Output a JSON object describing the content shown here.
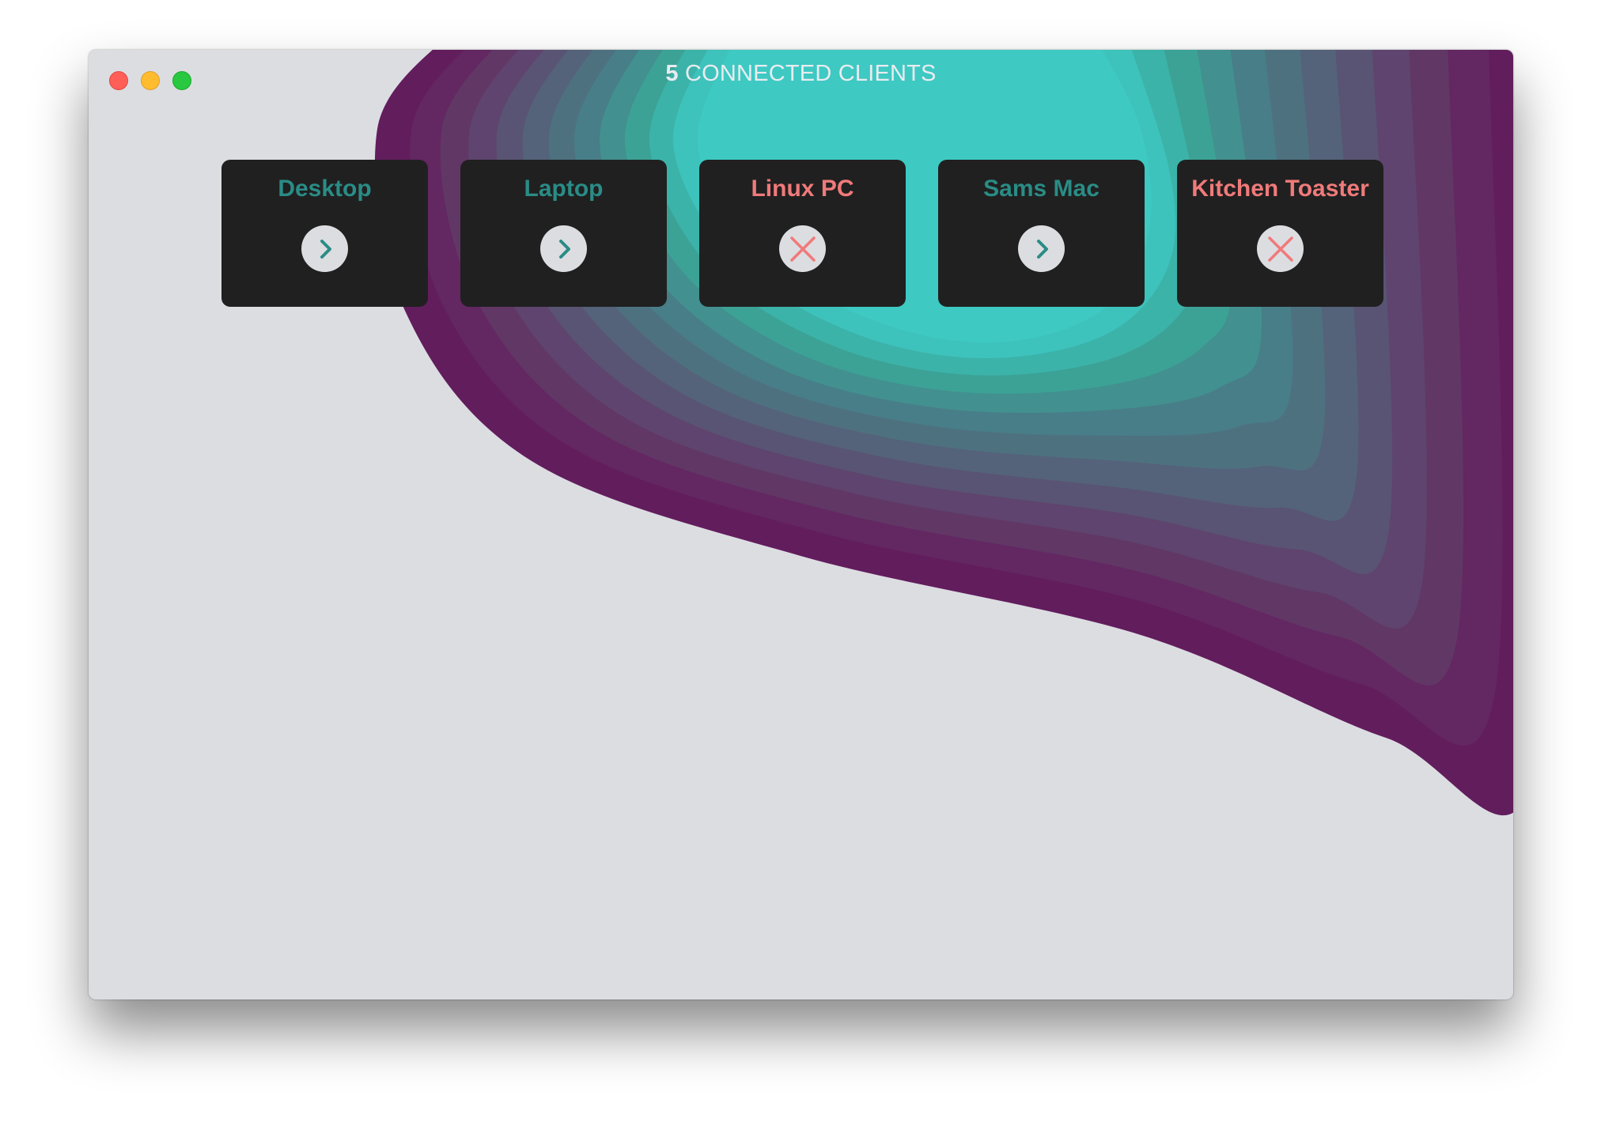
{
  "window": {
    "controls": [
      "close-icon",
      "minimize-icon",
      "maximize-icon"
    ],
    "title_count": "5",
    "title_text": "CONNECTED CLIENTS"
  },
  "colors": {
    "connected": "#2a8c86",
    "disconnected": "#f07a7a",
    "card_bg": "#202020",
    "window_bg": "#dcdde1"
  },
  "clients": [
    {
      "name": "Desktop",
      "status": "connected",
      "icon": "chevron-right-icon"
    },
    {
      "name": "Laptop",
      "status": "connected",
      "icon": "chevron-right-icon"
    },
    {
      "name": "Linux PC",
      "status": "disconnected",
      "icon": "close-x-icon"
    },
    {
      "name": "Sams Mac",
      "status": "connected",
      "icon": "chevron-right-icon"
    },
    {
      "name": "Kitchen Toaster",
      "status": "disconnected",
      "icon": "close-x-icon"
    }
  ]
}
